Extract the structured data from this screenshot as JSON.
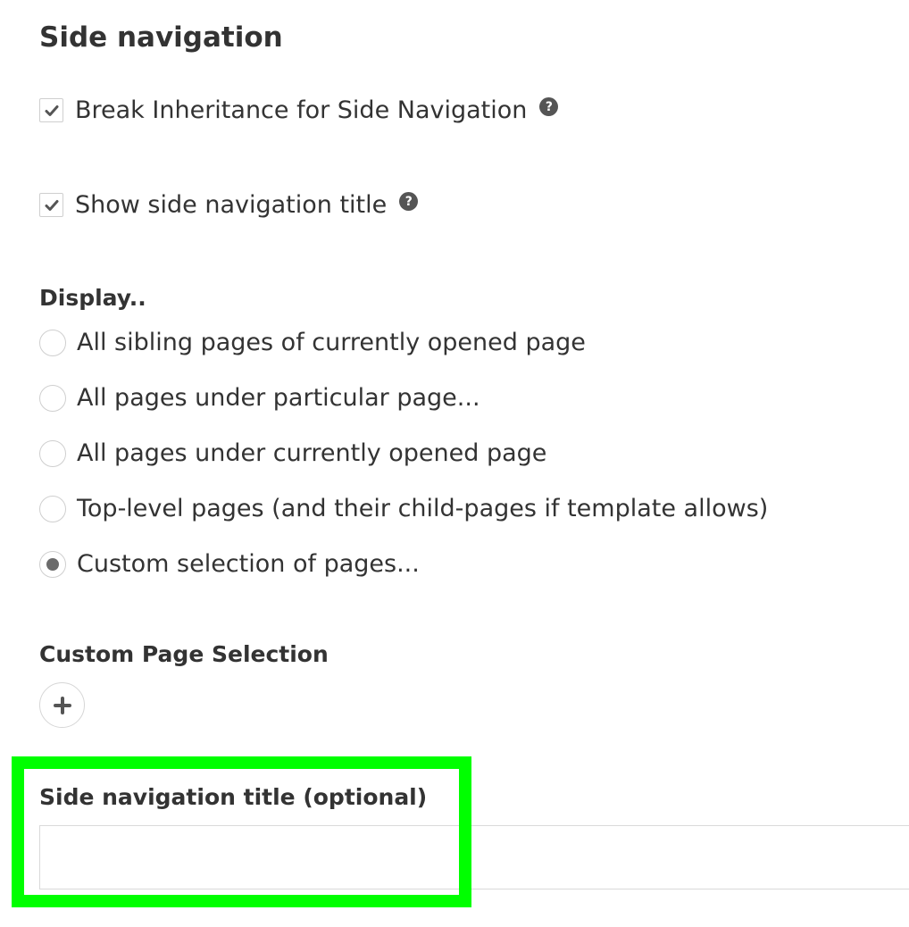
{
  "title": "Side navigation",
  "checkboxes": [
    {
      "label": "Break Inheritance for Side Navigation",
      "checked": true,
      "help_icon": "question-circle-icon"
    },
    {
      "label": "Show side navigation title",
      "checked": true,
      "help_icon": "question-circle-icon"
    }
  ],
  "display": {
    "label": "Display..",
    "options": [
      {
        "label": "All sibling pages of currently opened page",
        "selected": false
      },
      {
        "label": "All pages under particular page...",
        "selected": false
      },
      {
        "label": "All pages under currently opened page",
        "selected": false
      },
      {
        "label": "Top-level pages (and their child-pages if template allows)",
        "selected": false
      },
      {
        "label": "Custom selection of pages...",
        "selected": true
      }
    ]
  },
  "custom_page_selection": {
    "label": "Custom Page Selection",
    "add_icon": "plus-icon"
  },
  "side_nav_title_field": {
    "label": "Side navigation title (optional)",
    "value": "",
    "placeholder": ""
  },
  "colors": {
    "highlight": "#00ff00",
    "text": "#333333",
    "border": "#cfcfcf"
  }
}
